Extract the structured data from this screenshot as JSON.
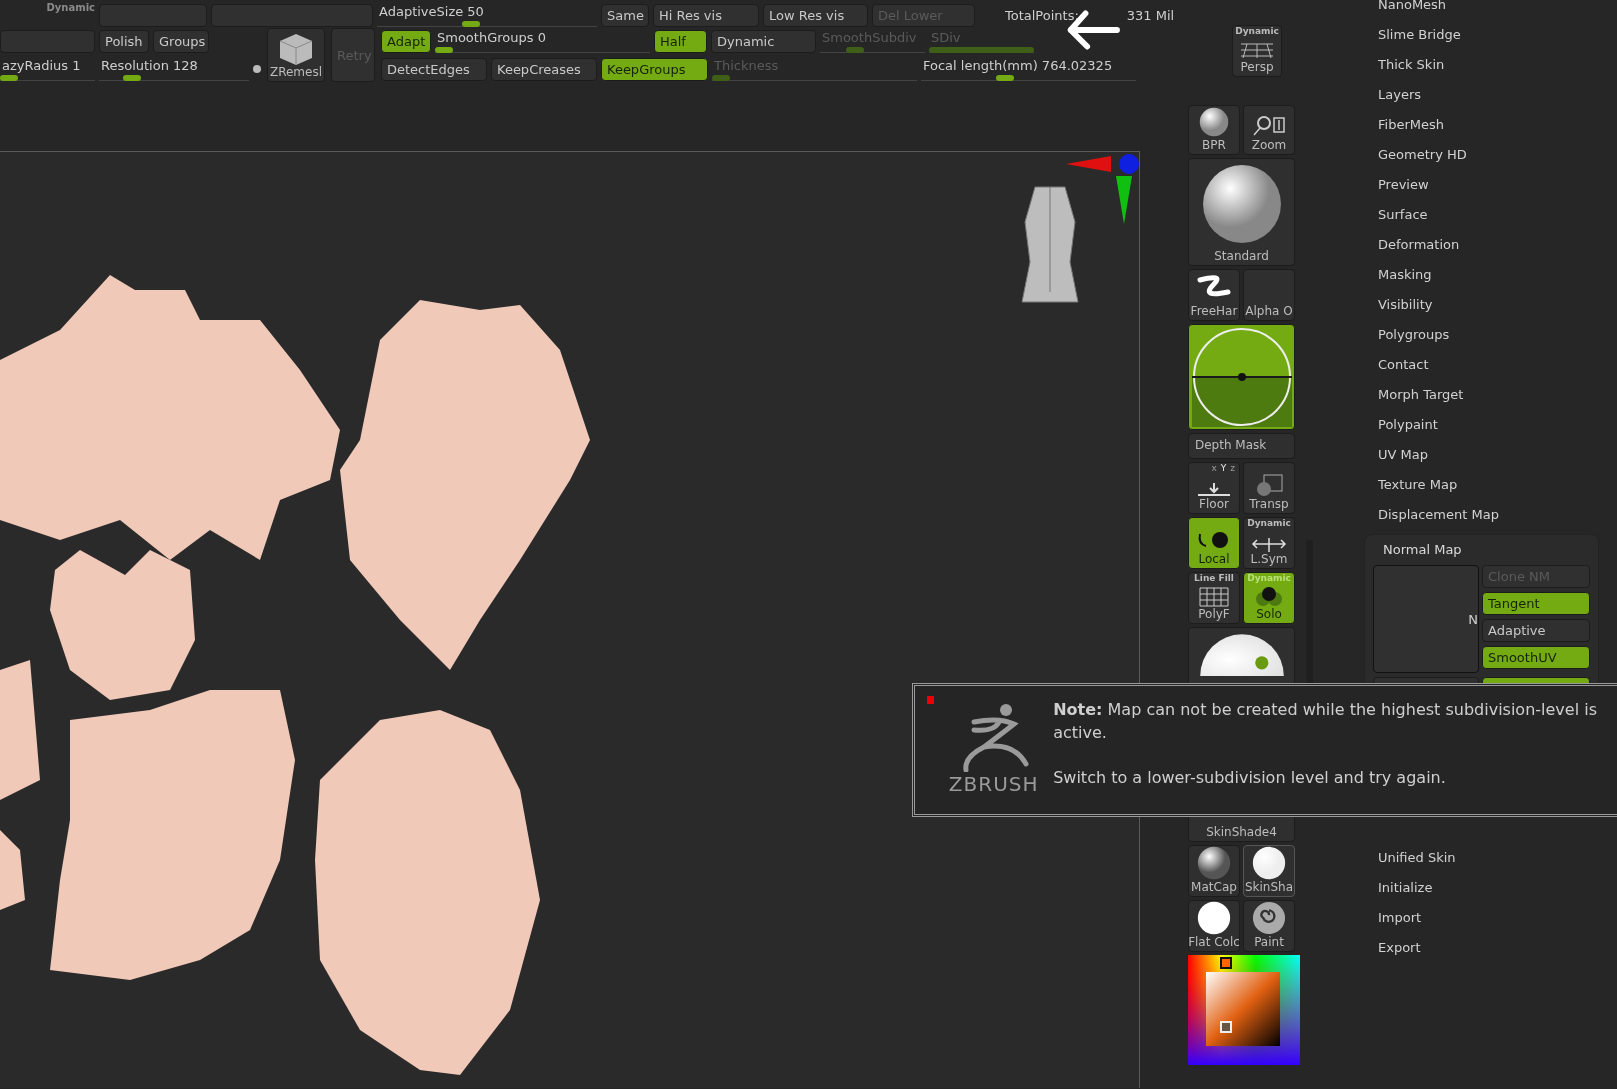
{
  "top_bar": {
    "row1": [
      {
        "kind": "caption",
        "text": "Dynamic"
      },
      {
        "kind": "blank"
      },
      {
        "kind": "blank"
      },
      {
        "kind": "slider",
        "text": "AdaptiveSize 50",
        "level": 0.42,
        "disabled": false
      },
      {
        "kind": "button",
        "text": "Same",
        "on": false,
        "disabled": false
      },
      {
        "kind": "button",
        "text": "Hi Res vis",
        "on": false,
        "disabled": false
      },
      {
        "kind": "button",
        "text": "Low Res vis",
        "on": false,
        "disabled": false
      },
      {
        "kind": "button",
        "text": "Del Lower",
        "on": false,
        "disabled": true
      },
      {
        "kind": "readout",
        "text": "TotalPoints:",
        "value": "331 Mil"
      }
    ],
    "left_rows": [
      [
        {
          "kind": "blank"
        },
        {
          "kind": "button",
          "text": "Polish",
          "on": false,
          "disabled": false
        },
        {
          "kind": "button",
          "text": "Groups",
          "on": false,
          "disabled": false
        }
      ],
      [
        {
          "kind": "slider",
          "text": "azyRadius 1",
          "level": 0.0,
          "disabled": false
        },
        {
          "kind": "slider",
          "text": "Resolution 128",
          "level": 0.18,
          "disabled": false
        },
        {
          "kind": "dot"
        }
      ]
    ],
    "zremesher": {
      "label": "ZRemesl",
      "retry": {
        "text": "Retry",
        "disabled": true
      }
    },
    "right_rows": [
      [
        {
          "kind": "button",
          "text": "Adapt",
          "on": true,
          "disabled": false
        },
        {
          "kind": "slider",
          "text": "SmoothGroups 0",
          "level": 0.0,
          "disabled": false
        },
        {
          "kind": "button",
          "text": "Half",
          "on": true,
          "disabled": false
        },
        {
          "kind": "button",
          "text": "Dynamic",
          "on": false,
          "disabled": false
        },
        {
          "kind": "slider",
          "text": "SmoothSubdiv",
          "level": 0.3,
          "disabled": true
        },
        {
          "kind": "bar",
          "text": "SDiv",
          "level": 1,
          "disabled": true
        }
      ],
      [
        {
          "kind": "button",
          "text": "DetectEdges",
          "on": false,
          "disabled": false
        },
        {
          "kind": "button",
          "text": "KeepCreases",
          "on": false,
          "disabled": false
        },
        {
          "kind": "button",
          "text": "KeepGroups",
          "on": true,
          "disabled": false
        },
        {
          "kind": "slider",
          "text": "Thickness",
          "level": 0.0,
          "disabled": true
        },
        {
          "kind": "slider",
          "text": "Focal length(mm) 764.02325",
          "level": 0.38,
          "disabled": false
        }
      ]
    ],
    "persp": {
      "badge": "Dynamic",
      "label": "Persp"
    }
  },
  "tools": {
    "bpr": "BPR",
    "zoom": "Zoom",
    "brush": "Standard",
    "stroke": "FreeHar",
    "alpha": "Alpha O",
    "depth_mask": "Depth Mask",
    "floor": {
      "label": "Floor",
      "axes": [
        {
          "label": "x",
          "on": false
        },
        {
          "label": "Y",
          "on": true
        },
        {
          "label": "z",
          "on": false
        }
      ]
    },
    "transp": "Transp",
    "local": {
      "label": "Local",
      "on": true
    },
    "lsym": {
      "badge": "Dynamic",
      "label": "L.Sym",
      "on": false
    },
    "polyf": {
      "badge": "Line Fill",
      "label": "PolyF",
      "on": false
    },
    "solo": {
      "badge": "Dynamic",
      "label": "Solo",
      "on": true
    },
    "material": "SkinShade4",
    "matcap": "MatCap",
    "skinsha": {
      "label": "SkinSha",
      "selected": true
    },
    "flat": "Flat Colc",
    "paint": "Paint"
  },
  "subpalettes_before": [
    "NanoMesh",
    "Slime Bridge",
    "Thick Skin",
    "Layers",
    "FiberMesh",
    "Geometry HD",
    "Preview",
    "Surface",
    "Deformation",
    "Masking",
    "Visibility",
    "Polygroups",
    "Contact",
    "Morph Target",
    "Polypaint",
    "UV Map",
    "Texture Map",
    "Displacement Map"
  ],
  "normal_map": {
    "title": "Normal Map",
    "preview_label": "N",
    "buttons": [
      {
        "text": "Clone NM",
        "on": false,
        "disabled": true
      },
      {
        "text": "Tangent",
        "on": true,
        "disabled": false
      },
      {
        "text": "Adaptive",
        "on": false,
        "disabled": false
      },
      {
        "text": "SmoothUV",
        "on": true,
        "disabled": false
      }
    ],
    "pair": [
      {
        "on": false
      },
      {
        "on": true
      }
    ]
  },
  "subpalettes_after": [
    "Unified Skin",
    "Initialize",
    "Import",
    "Export"
  ],
  "note": {
    "text": "**Note:** Map can not be created while the highest subdivision-level is active.",
    "hint": "Switch to a lower-subdivision level and try again.",
    "logo": "ZBRUSH"
  }
}
